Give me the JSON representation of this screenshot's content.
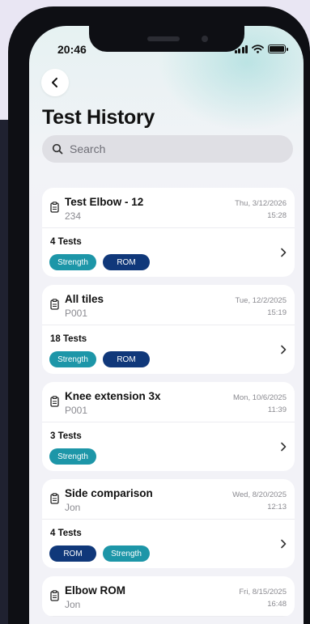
{
  "status_bar": {
    "time": "20:46"
  },
  "header": {
    "title": "Test History"
  },
  "search": {
    "placeholder": "Search"
  },
  "colors": {
    "teal_tag": "#1d96a8",
    "navy_tag": "#10387a"
  },
  "sessions": [
    {
      "title": "Test Elbow - 12",
      "subtitle": "234",
      "date": "Thu, 3/12/2026",
      "time": "15:28",
      "count": "4 Tests",
      "tags": [
        "Strength",
        "ROM"
      ]
    },
    {
      "title": "All tiles",
      "subtitle": "P001",
      "date": "Tue, 12/2/2025",
      "time": "15:19",
      "count": "18 Tests",
      "tags": [
        "Strength",
        "ROM"
      ]
    },
    {
      "title": "Knee extension 3x",
      "subtitle": "P001",
      "date": "Mon, 10/6/2025",
      "time": "11:39",
      "count": "3 Tests",
      "tags": [
        "Strength"
      ]
    },
    {
      "title": "Side comparison",
      "subtitle": "Jon",
      "date": "Wed, 8/20/2025",
      "time": "12:13",
      "count": "4 Tests",
      "tags": [
        "ROM",
        "Strength"
      ]
    },
    {
      "title": "Elbow ROM",
      "subtitle": "Jon",
      "date": "Fri, 8/15/2025",
      "time": "16:48",
      "count": "",
      "tags": []
    }
  ]
}
